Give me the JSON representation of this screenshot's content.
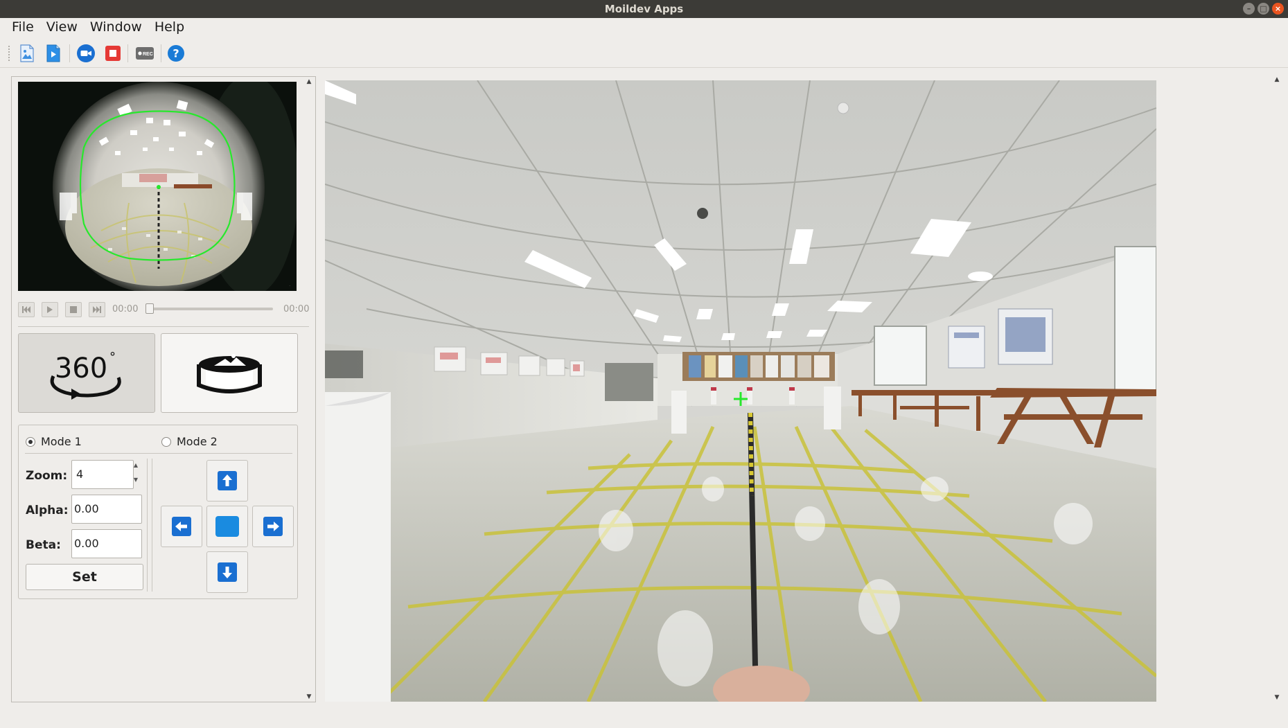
{
  "window": {
    "title": "Moildev Apps"
  },
  "menu": [
    "File",
    "View",
    "Window",
    "Help"
  ],
  "toolbar": {
    "buttons": [
      {
        "name": "open-image-button",
        "icon": "image-file-icon"
      },
      {
        "name": "open-video-button",
        "icon": "video-file-icon"
      },
      {
        "name": "open-camera-button",
        "icon": "camera-icon"
      },
      {
        "name": "stop-button",
        "icon": "stop-icon"
      },
      {
        "name": "record-button",
        "icon": "rec-icon"
      },
      {
        "name": "help-button",
        "icon": "help-icon"
      }
    ],
    "rec_label": "REC",
    "help_label": "?"
  },
  "player": {
    "current_time": "00:00",
    "total_time": "00:00",
    "progress": 0
  },
  "view_modes": {
    "mode_360_label": "360",
    "degree_symbol": "°"
  },
  "controls": {
    "mode1_label": "Mode 1",
    "mode2_label": "Mode 2",
    "selected_mode": "Mode 1",
    "zoom_label": "Zoom:",
    "zoom_value": "4",
    "alpha_label": "Alpha:",
    "alpha_value": "0.00",
    "beta_label": "Beta:",
    "beta_value": "0.00",
    "set_label": "Set"
  },
  "colors": {
    "accent_blue": "#1a6fd1",
    "stop_red": "#e53935",
    "overlay_green": "#27e82c",
    "titlebar": "#3c3b37"
  }
}
